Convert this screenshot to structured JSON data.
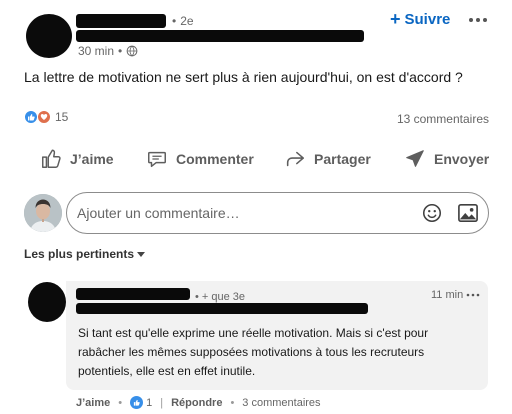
{
  "post": {
    "author_degree": "2e",
    "time": "30 min",
    "follow_label": "Suivre",
    "text": "La lettre de motivation ne sert plus à rien aujourd'hui, on est d'accord ?",
    "reaction_count": "15",
    "comments_count": "13 commentaires"
  },
  "actions": {
    "like": "J’aime",
    "comment": "Commenter",
    "share": "Partager",
    "send": "Envoyer"
  },
  "comment_box": {
    "placeholder": "Ajouter un commentaire…"
  },
  "sort": {
    "label": "Les plus pertinents"
  },
  "comment": {
    "degree": "+ que 3e",
    "time": "11 min",
    "text": "Si tant est qu'elle exprime une réelle motivation. Mais si c'est pour rabâcher les mêmes supposées motivations à tous les recruteurs potentiels, elle est en effet inutile.",
    "like_label": "J’aime",
    "like_count": "1",
    "reply_label": "Répondre",
    "replies_label": "3 commentaires"
  },
  "colors": {
    "accent": "#0a66c2",
    "like": "#378fe9",
    "love": "#df704d"
  }
}
